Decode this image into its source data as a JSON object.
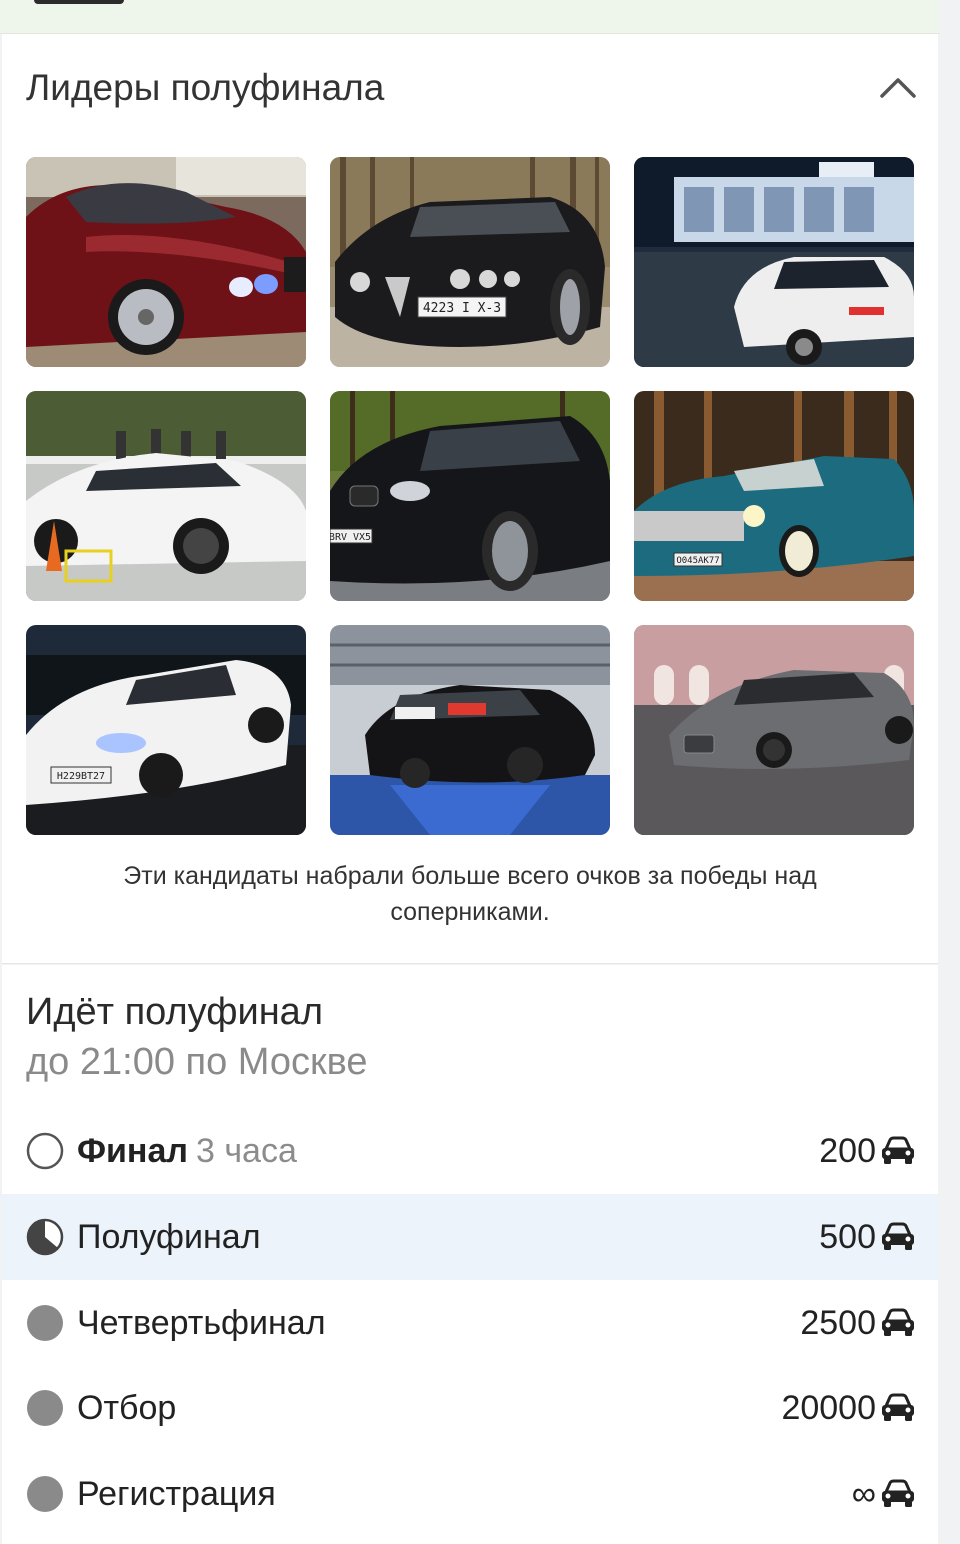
{
  "leaders": {
    "title": "Лидеры полуфинала",
    "caption": "Эти кандидаты набрали больше всего очков за победы над соперниками.",
    "photos": [
      {
        "plate": ""
      },
      {
        "plate": "4223 I X-3"
      },
      {
        "plate": ""
      },
      {
        "plate": ""
      },
      {
        "plate": "BRV VX5"
      },
      {
        "plate": "О045АК77"
      },
      {
        "plate": "Н229ВТ27"
      },
      {
        "plate": ""
      },
      {
        "plate": ""
      }
    ]
  },
  "stages": {
    "title": "Идёт полуфинал",
    "subtitle": "до 21:00 по Москве",
    "rows": [
      {
        "name": "Финал",
        "duration": "3 часа",
        "count": "200",
        "state": "upcoming"
      },
      {
        "name": "Полуфинал",
        "duration": "",
        "count": "500",
        "state": "current"
      },
      {
        "name": "Четвертьфинал",
        "duration": "",
        "count": "2500",
        "state": "done"
      },
      {
        "name": "Отбор",
        "duration": "",
        "count": "20000",
        "state": "done"
      },
      {
        "name": "Регистрация",
        "duration": "",
        "count": "∞",
        "state": "done"
      }
    ]
  },
  "icons": {
    "collapse": "chevron-up-icon",
    "car": "car-icon"
  },
  "colors": {
    "active_row": "#edf3fb",
    "done_dot": "#8a8a8a"
  }
}
